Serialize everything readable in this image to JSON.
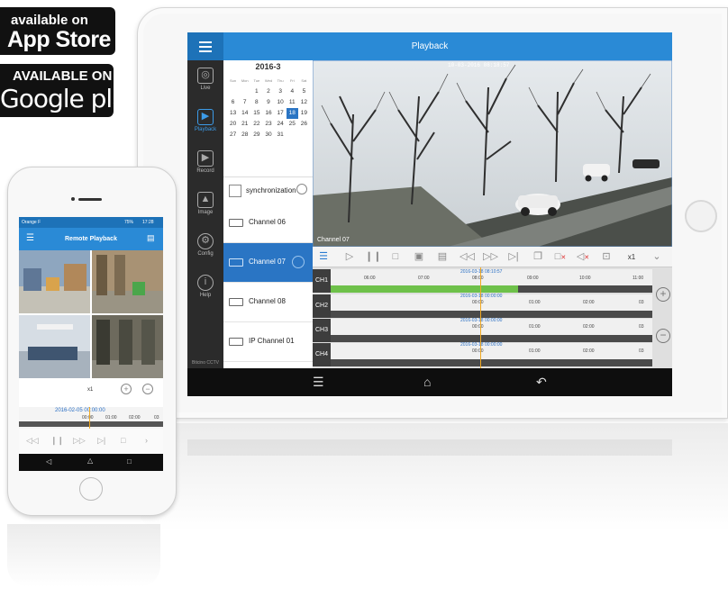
{
  "badges": {
    "apple_line1": "available on",
    "apple_line2": "App Store",
    "google_line1": "AVAILABLE ON",
    "google_line2": "Google play"
  },
  "tablet": {
    "title": "Playback",
    "sidebar": [
      {
        "label": "Live",
        "icon": "camera-icon"
      },
      {
        "label": "Playback",
        "icon": "playback-icon",
        "active": true
      },
      {
        "label": "Record",
        "icon": "record-icon"
      },
      {
        "label": "Image",
        "icon": "image-icon"
      },
      {
        "label": "Config",
        "icon": "gear-icon"
      },
      {
        "label": "Help",
        "icon": "info-icon"
      }
    ],
    "brand": "Bticino CCTV",
    "calendar": {
      "title": "2016-3",
      "weekdays": [
        "Sun",
        "Mon",
        "Tue",
        "Wed",
        "Thu",
        "Fri",
        "Sat"
      ],
      "weeks": [
        [
          "",
          "",
          "1",
          "2",
          "3",
          "4",
          "5"
        ],
        [
          "6",
          "7",
          "8",
          "9",
          "10",
          "11",
          "12"
        ],
        [
          "13",
          "14",
          "15",
          "16",
          "17",
          "18",
          "19"
        ],
        [
          "20",
          "21",
          "22",
          "23",
          "24",
          "25",
          "26"
        ],
        [
          "27",
          "28",
          "29",
          "30",
          "31",
          "",
          ""
        ]
      ],
      "selected": "18"
    },
    "sync_label": "synchronization",
    "channels": [
      "Channel 06",
      "Channel 07",
      "Channel 08",
      "IP Channel 01"
    ],
    "active_channel": "Channel 07",
    "video": {
      "timestamp": "10-03-2016 08:18:57",
      "label": "Channel 07"
    },
    "speed": "x1",
    "timeline": {
      "rows": [
        {
          "label": "CH1",
          "date": "2016-03-18 08:10:57",
          "ticks": [
            "06:00",
            "07:00",
            "08:00",
            "09:00",
            "10:00",
            "11:00"
          ]
        },
        {
          "label": "CH2",
          "date": "2016-03-18 00:00:00",
          "ticks": [
            "00:00",
            "01:00",
            "02:00",
            "03"
          ]
        },
        {
          "label": "CH3",
          "date": "2016-03-18 00:00:00",
          "ticks": [
            "00:00",
            "01:00",
            "02:00",
            "03"
          ]
        },
        {
          "label": "CH4",
          "date": "2016-03-18 00:00:00",
          "ticks": [
            "00:00",
            "01:00",
            "02:00",
            "03"
          ]
        }
      ]
    }
  },
  "phone": {
    "status_left": "Orange F",
    "status_battery": "75%",
    "status_time": "17:28",
    "title": "Remote Playback",
    "speed": "x1",
    "timeline_date": "2016-02-05 00:00:00",
    "timeline_ticks": [
      "00:00",
      "01:00",
      "02:00",
      "03"
    ]
  }
}
